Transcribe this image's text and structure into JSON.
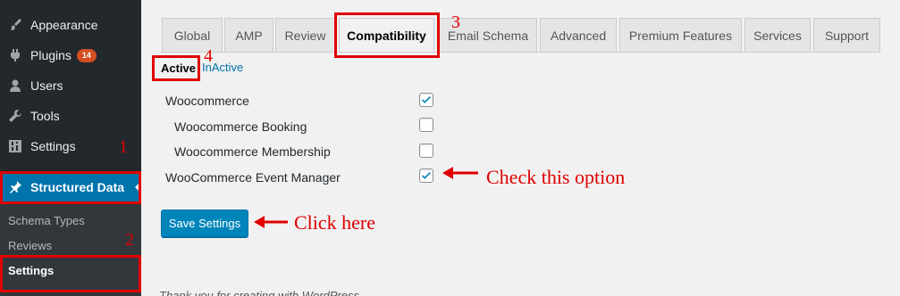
{
  "sidebar": {
    "items": [
      {
        "label": "Appearance",
        "icon": "paint-brush-icon"
      },
      {
        "label": "Plugins",
        "icon": "plug-icon",
        "badge": "14"
      },
      {
        "label": "Users",
        "icon": "user-icon"
      },
      {
        "label": "Tools",
        "icon": "wrench-icon"
      },
      {
        "label": "Settings",
        "icon": "settings-icon"
      },
      {
        "label": "Structured Data",
        "icon": "pin-icon",
        "active": true
      }
    ],
    "submenu": [
      {
        "label": "Schema Types"
      },
      {
        "label": "Reviews"
      },
      {
        "label": "Settings",
        "current": true
      }
    ]
  },
  "tabs": [
    {
      "label": "Global"
    },
    {
      "label": "AMP"
    },
    {
      "label": "Review"
    },
    {
      "label": "Compatibility",
      "active": true
    },
    {
      "label": "Email Schema"
    },
    {
      "label": "Advanced"
    },
    {
      "label": "Premium Features"
    },
    {
      "label": "Services"
    },
    {
      "label": "Support"
    }
  ],
  "subtabs": {
    "active": "Active",
    "inactive": "InActive"
  },
  "options": [
    {
      "label": "Woocommerce",
      "checked": true
    },
    {
      "label": "Woocommerce Booking",
      "checked": false
    },
    {
      "label": "Woocommerce Membership",
      "checked": false
    },
    {
      "label": "WooCommerce Event Manager",
      "checked": true
    }
  ],
  "save_button": "Save Settings",
  "footer_text": "Thank you for creating with WordPress.",
  "annotations": {
    "num1": "1",
    "num2": "2",
    "num3": "3",
    "num4": "4",
    "check_note": "Check this option",
    "click_note": "Click here"
  },
  "colors": {
    "accent": "#0073aa",
    "sidebar_bg": "#23282d",
    "annotation_red": "#e00000"
  }
}
